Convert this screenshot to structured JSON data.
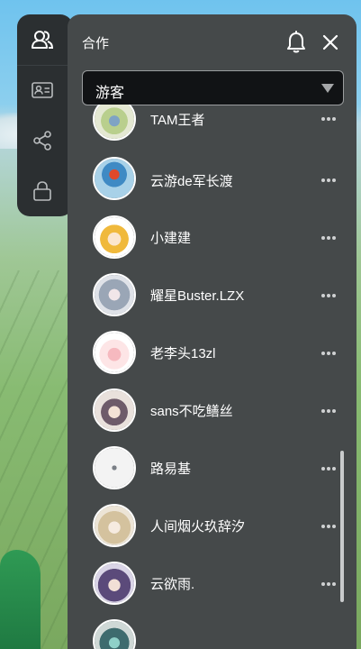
{
  "rail": {
    "items": [
      {
        "icon": "users-icon"
      },
      {
        "icon": "id-card-icon"
      },
      {
        "icon": "share-icon"
      },
      {
        "icon": "lock-icon"
      }
    ]
  },
  "panel": {
    "title": "合作",
    "select": {
      "value": "游客"
    }
  },
  "players": [
    {
      "name": "TAM王者",
      "avatar_color": "#c9cf9c"
    },
    {
      "name": "云游de军长渡",
      "avatar_color": "#7db7d9"
    },
    {
      "name": "小建建",
      "avatar_color": "#f2c24d"
    },
    {
      "name": "耀星Buster.LZX",
      "avatar_color": "#9aa4b4"
    },
    {
      "name": "老李头13zl",
      "avatar_color": "#f4d1d2"
    },
    {
      "name": "sans不吃鳝丝",
      "avatar_color": "#c8b0a8"
    },
    {
      "name": "路易基",
      "avatar_color": "#f2f2f2"
    },
    {
      "name": "人间烟火玖辞汐",
      "avatar_color": "#d6c6a3"
    },
    {
      "name": "云欲雨.",
      "avatar_color": "#6e5b8c"
    },
    {
      "name": "",
      "avatar_color": "#3e6b6e"
    }
  ],
  "colors": {
    "panel_bg": "#45494a",
    "rail_bg": "#2b2f31",
    "select_bg": "#111315",
    "text": "#ffffff"
  }
}
